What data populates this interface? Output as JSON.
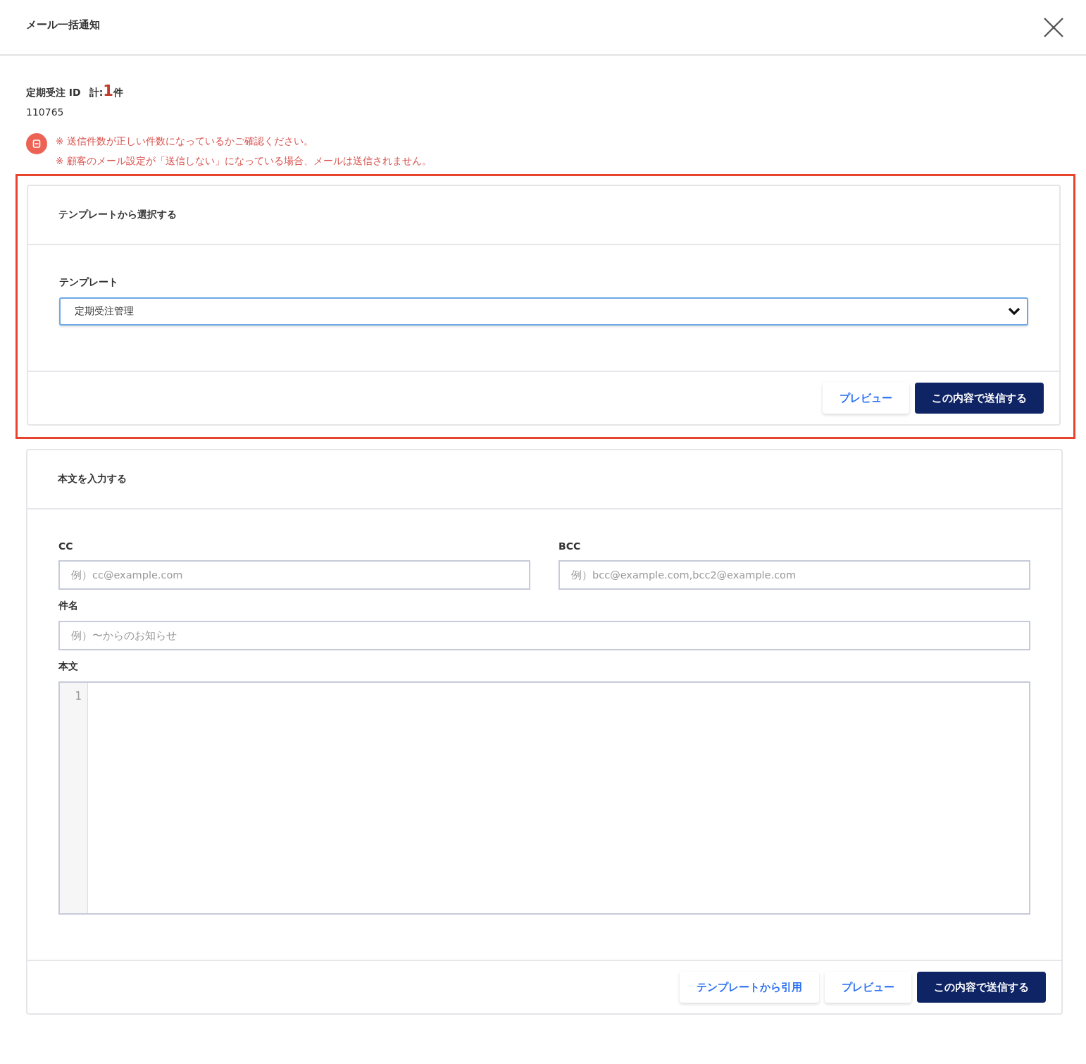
{
  "dialog": {
    "title": "メール一括通知"
  },
  "summary": {
    "label": "定期受注 ID",
    "total_label": "計:",
    "total_count": "1",
    "total_unit": "件",
    "ids": [
      "110765"
    ]
  },
  "notices": [
    "※ 送信件数が正しい件数になっているかご確認ください。",
    "※ 顧客のメール設定が「送信しない」になっている場合、メールは送信されません。"
  ],
  "template_card": {
    "highlighted": true,
    "title": "テンプレートから選択する",
    "field_label": "テンプレート",
    "select_value": "定期受注管理",
    "focused": true,
    "buttons": [
      {
        "label": "プレビュー",
        "kind": "secondary"
      },
      {
        "label": "この内容で送信する",
        "kind": "primary"
      }
    ]
  },
  "body_card": {
    "highlighted": false,
    "title": "本文を入力する",
    "cc": {
      "label": "CC",
      "placeholder": "例）cc@example.com"
    },
    "bcc": {
      "label": "BCC",
      "placeholder": "例）bcc@example.com,bcc2@example.com"
    },
    "subject": {
      "label": "件名",
      "placeholder": "例）〜からのお知らせ"
    },
    "body": {
      "label": "本文",
      "line_numbers": [
        "1"
      ]
    },
    "buttons": [
      {
        "label": "テンプレートから引用",
        "kind": "secondary"
      },
      {
        "label": "プレビュー",
        "kind": "secondary"
      },
      {
        "label": "この内容で送信する",
        "kind": "primary"
      }
    ]
  }
}
